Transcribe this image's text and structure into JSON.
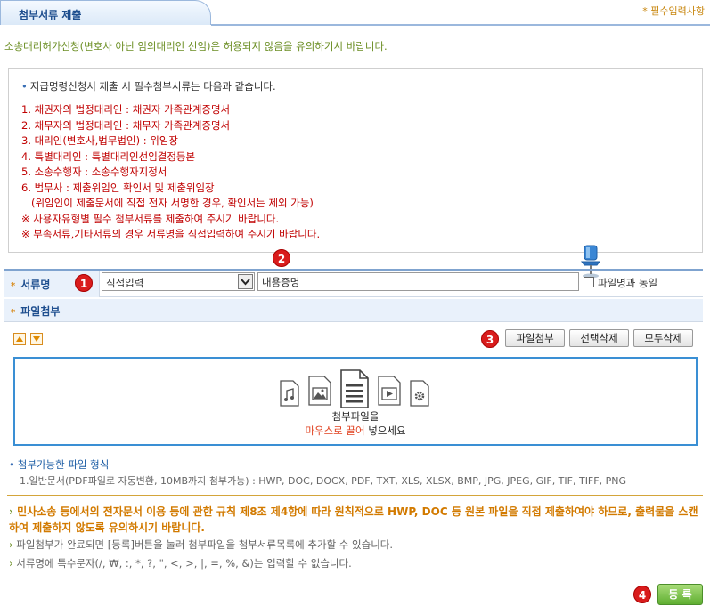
{
  "header": {
    "title": "첨부서류 제출",
    "required_note": "* 필수입력사항"
  },
  "warning": "소송대리허가신청(변호사 아닌 임의대리인 선임)은 허용되지 않음을 유의하기시 바랍니다.",
  "notice": {
    "heading": "지급명령신청서 제출 시 필수첨부서류는 다음과 같습니다.",
    "items": [
      "1. 채권자의 법정대리인 : 채권자 가족관계증명서",
      "2. 채무자의 법정대리인 : 채무자 가족관계증명서",
      "3. 대리인(변호사,법무법인) : 위임장",
      "4. 특별대리인 : 특별대리인선임결정등본",
      "5. 소송수행자 : 소송수행자지정서",
      "6. 법무사 : 제출위임인 확인서 및 제출위임장",
      "   (위임인이 제출문서에 직접 전자 서명한 경우, 확인서는 제외 가능)",
      "※ 사용자유형별 필수 첨부서류를 제출하여 주시기 바랍니다.",
      "※ 부속서류,기타서류의 경우 서류명을 직접입력하여 주시기 바랍니다."
    ]
  },
  "doc_row": {
    "label": "서류명",
    "select_value": "직접입력",
    "input_value": "내용증명",
    "same_as_filename_label": "파일명과 동일"
  },
  "attach_row": {
    "label": "파일첨부"
  },
  "toolbar": {
    "attach_button": "파일첨부",
    "delete_selected_button": "선택삭제",
    "delete_all_button": "모두삭제"
  },
  "drop_zone": {
    "line1": "첨부파일을",
    "line2_highlight": "마우스로 끌어",
    "line2_rest": " 넣으세요"
  },
  "formats": {
    "title": "첨부가능한 파일 형식",
    "list": "1.일반문서(PDF파일로 자동변환, 10MB까지 첨부가능) : HWP, DOC, DOCX, PDF, TXT, XLS, XLSX, BMP, JPG, JPEG, GIF, TIF, TIFF, PNG"
  },
  "rules": {
    "main": "민사소송 등에서의 전자문서 이용 등에 관한 규칙 제8조 제4항에 따라 원칙적으로 HWP, DOC 등 원본 파일을 직접 제출하여야 하므로, 출력물을 스캔하여 제출하지 않도록 유의하시기 바랍니다.",
    "sub1": "파일첨부가 완료되면 [등록]버튼을 눌러 첨부파일을 첨부서류목록에 추가할 수 있습니다.",
    "sub2": "서류명에 특수문자(/, ₩, :, *, ?, \", <, >, |, =, %, &)는 입력할 수 없습니다."
  },
  "register_button": "등 록",
  "badges": [
    "1",
    "2",
    "3",
    "4"
  ],
  "icons": [
    "music-file-icon",
    "image-file-icon",
    "document-file-icon",
    "video-file-icon",
    "settings-file-icon",
    "pin-icon"
  ],
  "colors": {
    "accent_blue": "#1f4f8f",
    "notice_red": "#c00000",
    "badge_red": "#d91c1c",
    "orange": "#d27a00",
    "green_button": "#5fae31"
  }
}
